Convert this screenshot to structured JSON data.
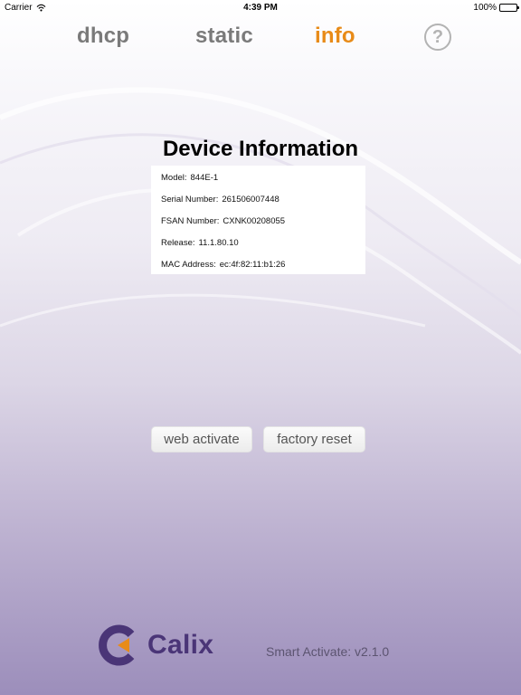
{
  "status_bar": {
    "carrier": "Carrier",
    "time": "4:39 PM",
    "battery": "100%"
  },
  "tabs": [
    {
      "label": "dhcp",
      "active": false
    },
    {
      "label": "static",
      "active": false
    },
    {
      "label": "info",
      "active": true
    }
  ],
  "help_label": "?",
  "device_info": {
    "title": "Device Information",
    "rows": [
      {
        "label": "Model:",
        "value": "844E-1"
      },
      {
        "label": "Serial Number:",
        "value": "261506007448"
      },
      {
        "label": "FSAN Number:",
        "value": "CXNK00208055"
      },
      {
        "label": "Release:",
        "value": "11.1.80.10"
      },
      {
        "label": "MAC Address:",
        "value": "ec:4f:82:11:b1:26"
      }
    ]
  },
  "buttons": {
    "web_activate": "web activate",
    "factory_reset": "factory reset"
  },
  "footer": {
    "brand": "Calix",
    "version": "Smart Activate: v2.1.0"
  },
  "colors": {
    "active_tab": "#e88b18",
    "inactive_tab": "#7a7a7a",
    "brand_purple": "#4a3577",
    "brand_orange": "#e88b18"
  }
}
